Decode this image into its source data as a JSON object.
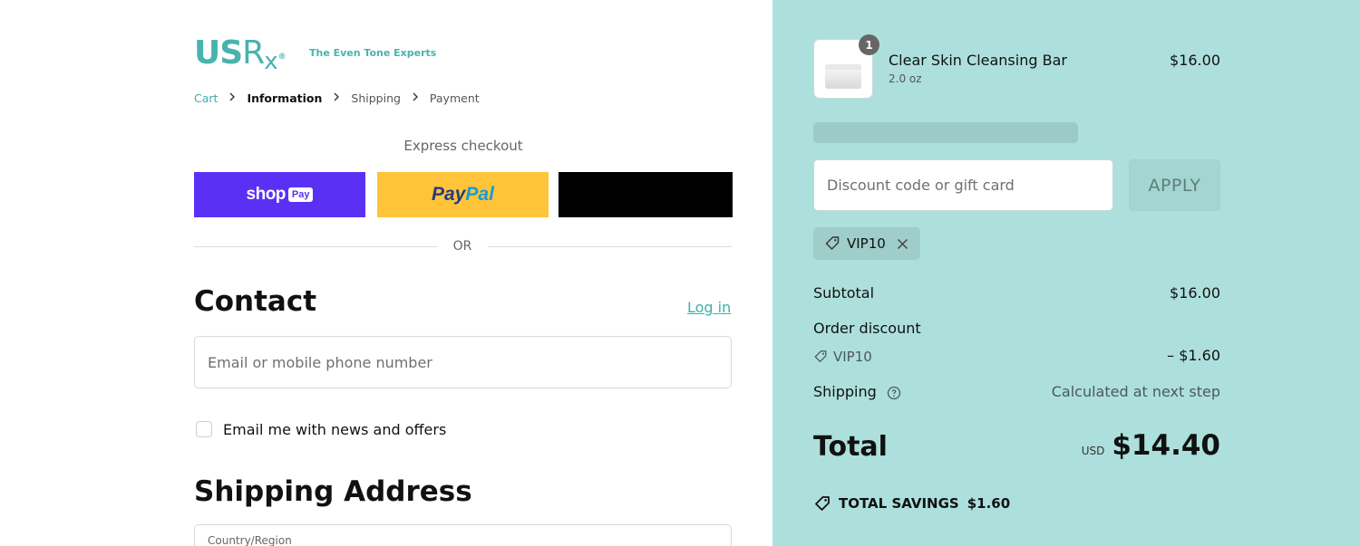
{
  "brand": {
    "logo_text_us": "US",
    "logo_text_rx": "R",
    "logo_text_x": "x",
    "registered": "®",
    "tagline": "The Even Tone Experts",
    "accent_color": "#49b3ad"
  },
  "breadcrumb": {
    "items": [
      "Cart",
      "Information",
      "Shipping",
      "Payment"
    ],
    "current": "Information",
    "separator": ">"
  },
  "express": {
    "label": "Express checkout",
    "shop_pay": {
      "word": "shop",
      "chip": "Pay"
    },
    "paypal": {
      "part1": "Pay",
      "part2": "Pal"
    },
    "third_button_label": ""
  },
  "divider_text": "OR",
  "contact": {
    "heading": "Contact",
    "login_link": "Log in",
    "email_placeholder": "Email or mobile phone number",
    "newsletter_label": "Email me with news and offers",
    "newsletter_checked": false
  },
  "shipping_address": {
    "heading": "Shipping Address",
    "country_label": "Country/Region"
  },
  "order": {
    "item": {
      "name": "Clear Skin Cleansing Bar",
      "variant": "2.0 oz",
      "price": "$16.00",
      "quantity": "1"
    },
    "discount": {
      "placeholder": "Discount code or gift card",
      "apply_label": "APPLY",
      "applied_code": "VIP10"
    },
    "subtotal": {
      "label": "Subtotal",
      "value": "$16.00"
    },
    "order_discount": {
      "label": "Order discount",
      "code": "VIP10",
      "value": "– $1.60"
    },
    "shipping": {
      "label": "Shipping",
      "value": "Calculated at next step"
    },
    "total": {
      "label": "Total",
      "currency": "USD",
      "value": "$14.40"
    },
    "savings": {
      "label": "TOTAL SAVINGS",
      "value": "$1.60"
    }
  },
  "colors": {
    "summary_bg": "#ade0dc",
    "shop_pay_bg": "#5a31f4",
    "paypal_bg": "#ffc439",
    "link": "#3eb0aa"
  },
  "icons": [
    "chevron-right-icon",
    "tag-icon",
    "close-icon",
    "help-circle-icon",
    "savings-tag-icon"
  ]
}
